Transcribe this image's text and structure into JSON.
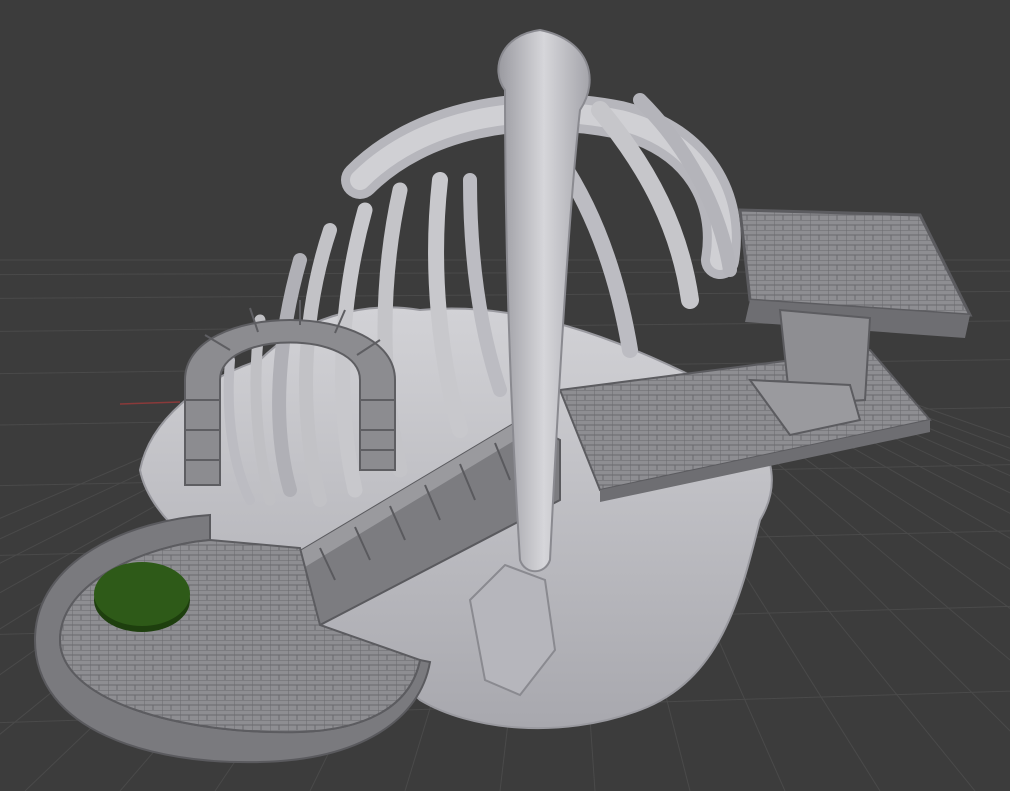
{
  "viewport": {
    "background_color": "#3c3c3c",
    "grid_color": "#4a4a4a",
    "x_axis_color": "#8a3a3a",
    "model_color": "#c4c4c8",
    "model_shadow_color": "#8e8e94",
    "stone_color": "#8c8c90",
    "stone_dark_color": "#6e6e72",
    "marker_color": "#2e5a18"
  },
  "scene": {
    "objects": [
      "grid-floor",
      "rock-base",
      "ribcage",
      "stone-archway",
      "staircase",
      "stone-walkway",
      "raised-platform",
      "stone-throne",
      "bone-pillar",
      "round-platform",
      "green-marker"
    ]
  }
}
